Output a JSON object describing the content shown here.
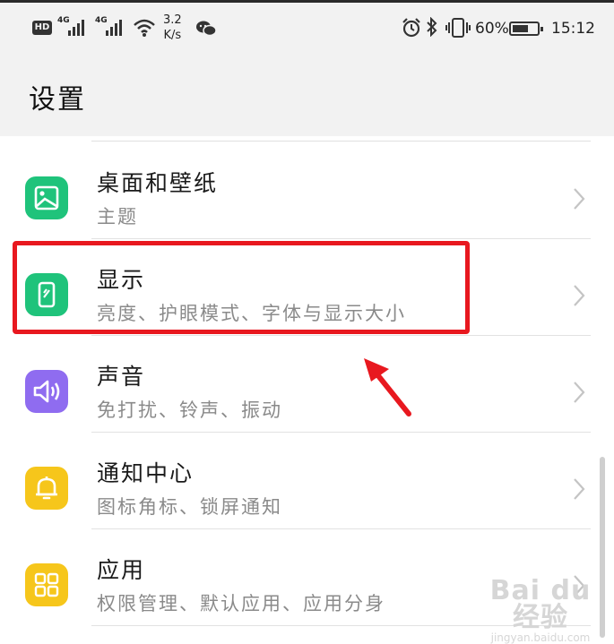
{
  "status_bar": {
    "hd": "HD",
    "net1": "4G",
    "net2": "4G",
    "speed_value": "3.2",
    "speed_unit": "K/s",
    "battery_percent": "60%",
    "time": "15:12"
  },
  "header": {
    "title": "设置"
  },
  "settings_items": [
    {
      "title": "桌面和壁纸",
      "subtitle": "主题",
      "icon": "wallpaper-icon",
      "color": "#1fc37b"
    },
    {
      "title": "显示",
      "subtitle": "亮度、护眼模式、字体与显示大小",
      "icon": "display-icon",
      "color": "#1fc37b"
    },
    {
      "title": "声音",
      "subtitle": "免打扰、铃声、振动",
      "icon": "speaker-icon",
      "color": "#8f6cf0"
    },
    {
      "title": "通知中心",
      "subtitle": "图标角标、锁屏通知",
      "icon": "bell-icon",
      "color": "#f6c61b"
    },
    {
      "title": "应用",
      "subtitle": "权限管理、默认应用、应用分身",
      "icon": "apps-grid-icon",
      "color": "#f6c61b"
    }
  ],
  "annotation": {
    "highlight_color": "#e8181f"
  },
  "watermark": {
    "brand": "Bai du 经验",
    "url": "jingyan.baidu.com"
  }
}
